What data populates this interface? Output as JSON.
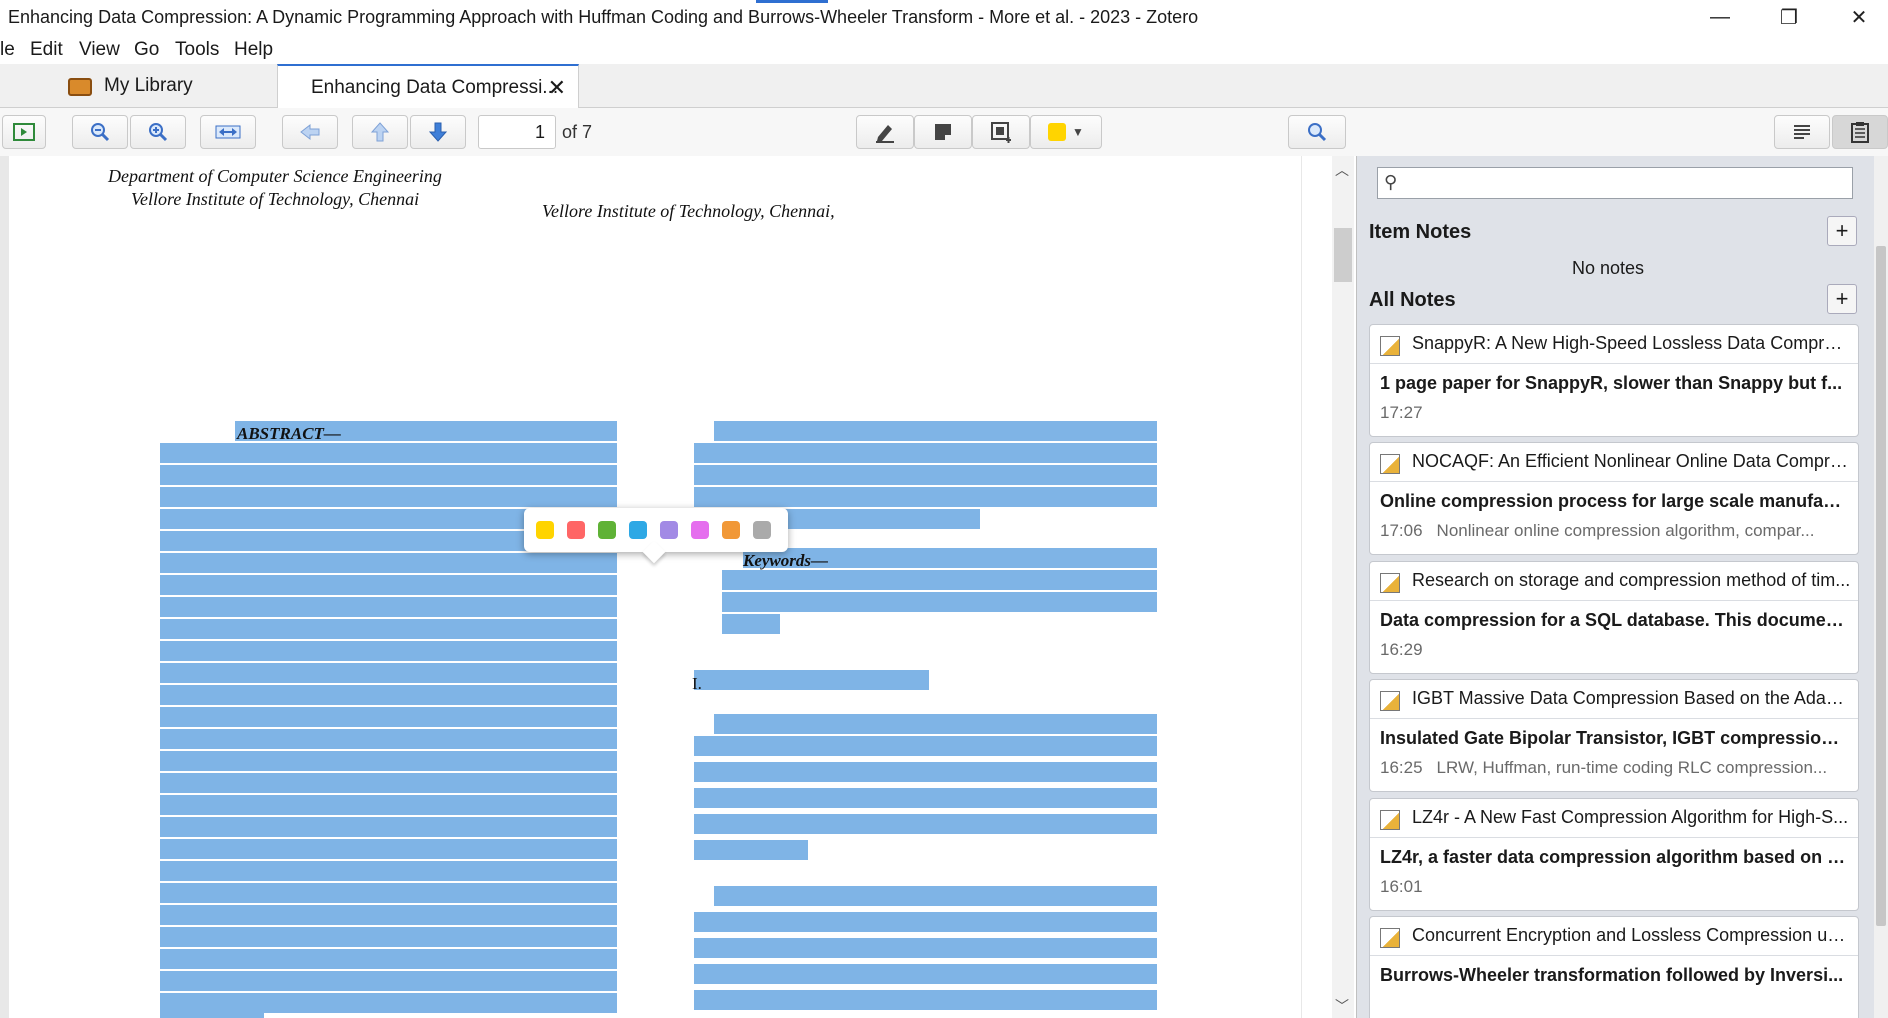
{
  "window": {
    "title": "Enhancing Data Compression: A Dynamic Programming Approach with Huffman Coding and Burrows-Wheeler Transform - More et al. - 2023 - Zotero",
    "minimize": "—",
    "restore": "❐",
    "close": "✕"
  },
  "menu": [
    "le",
    "Edit",
    "View",
    "Go",
    "Tools",
    "Help"
  ],
  "tabs": {
    "library": "My Library",
    "document": "Enhancing Data Compressi...",
    "close": "✕"
  },
  "toolbar": {
    "page_number": "1",
    "page_of": "of 7",
    "highlight_color": "#ffd400"
  },
  "document": {
    "affil_left_1": "Department of Computer Science Engineering",
    "affil_left_2": "Vellore Institute of Technology, Chennai",
    "affil_right": "Vellore Institute of Technology, Chennai,",
    "abstract_label": "ABSTRACT—",
    "keywords_label": "Keywords—",
    "section_label": "I.",
    "highlight_color": "#7fb4e6"
  },
  "color_popup": [
    "#ffd400",
    "#ff6666",
    "#5fb236",
    "#2ea8e5",
    "#a28ae5",
    "#e56eee",
    "#f19837",
    "#aaaaaa"
  ],
  "notes_pane": {
    "item_notes_title": "Item Notes",
    "no_notes": "No notes",
    "all_notes_title": "All Notes",
    "plus": "+",
    "cards": [
      {
        "parent": "SnappyR: A New High-Speed Lossless Data Compress...",
        "title": "1 page paper for SnappyR, slower than Snappy but f...",
        "time": "17:27",
        "snippet": ""
      },
      {
        "parent": "NOCAQF: An Efficient Nonlinear Online Data Compre...",
        "title": "Online compression process for large scale manufact...",
        "time": "17:06",
        "snippet": "Nonlinear online compression algorithm, compar..."
      },
      {
        "parent": "Research on storage and compression method of tim...",
        "title": "Data compression for a SQL database. This document...",
        "time": "16:29",
        "snippet": ""
      },
      {
        "parent": "IGBT Massive Data Compression Based on the Adapti...",
        "title": "Insulated Gate Bipolar Transistor, IGBT compression f...",
        "time": "16:25",
        "snippet": "LRW, Huffman, run-time coding RLC compression..."
      },
      {
        "parent": "LZ4r - A New Fast Compression Algorithm for High-S...",
        "title": "LZ4r, a faster data compression algorithm based on L...",
        "time": "16:01",
        "snippet": ""
      },
      {
        "parent": "Concurrent Encryption and Lossless Compression usi...",
        "title": "Burrows-Wheeler transformation followed by Inversi...",
        "time": "",
        "snippet": ""
      }
    ]
  }
}
